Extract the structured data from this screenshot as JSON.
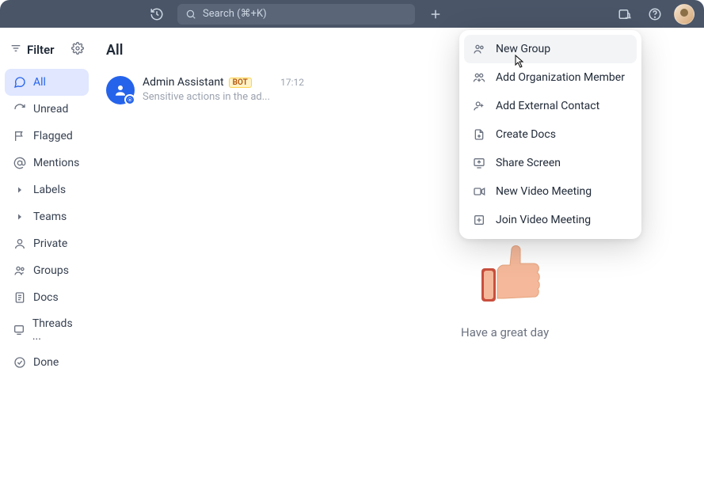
{
  "topbar": {
    "search_placeholder": "Search (⌘+K)"
  },
  "sidebar": {
    "filter_label": "Filter",
    "items": [
      {
        "id": "all",
        "label": "All"
      },
      {
        "id": "unread",
        "label": "Unread"
      },
      {
        "id": "flagged",
        "label": "Flagged"
      },
      {
        "id": "mentions",
        "label": "Mentions"
      },
      {
        "id": "labels",
        "label": "Labels"
      },
      {
        "id": "teams",
        "label": "Teams"
      },
      {
        "id": "private",
        "label": "Private"
      },
      {
        "id": "groups",
        "label": "Groups"
      },
      {
        "id": "docs",
        "label": "Docs"
      },
      {
        "id": "threads",
        "label": "Threads ..."
      },
      {
        "id": "done",
        "label": "Done"
      }
    ]
  },
  "list": {
    "title": "All",
    "chats": [
      {
        "name": "Admin Assistant",
        "badge": "BOT",
        "preview": "Sensitive actions in the ad...",
        "time": "17:12"
      }
    ]
  },
  "main": {
    "greeting": "Have a great day"
  },
  "menu": {
    "items": [
      {
        "id": "new-group",
        "label": "New Group"
      },
      {
        "id": "add-org-member",
        "label": "Add Organization Member"
      },
      {
        "id": "add-external-contact",
        "label": "Add External Contact"
      },
      {
        "id": "create-docs",
        "label": "Create Docs"
      },
      {
        "id": "share-screen",
        "label": "Share Screen"
      },
      {
        "id": "new-video-meeting",
        "label": "New Video Meeting"
      },
      {
        "id": "join-video-meeting",
        "label": "Join Video Meeting"
      }
    ]
  }
}
